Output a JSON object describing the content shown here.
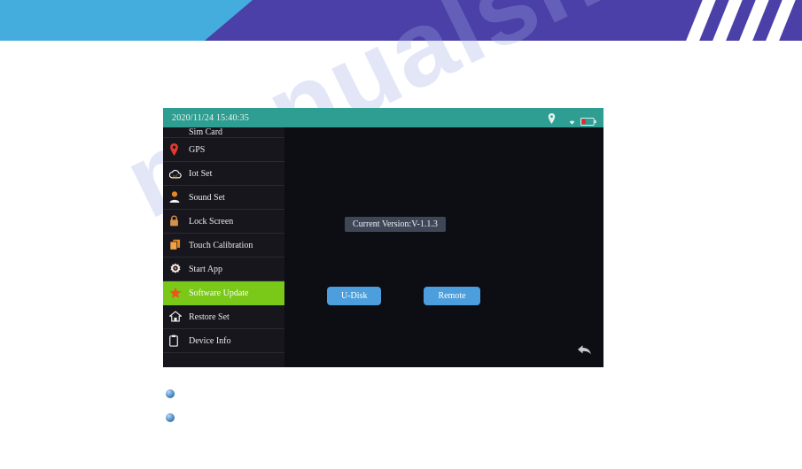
{
  "banner": {
    "blue_color": "#45adde",
    "purple_color": "#4b3fa8",
    "stripe_color": "#ffffff"
  },
  "watermark": {
    "text": "manualshive.com",
    "color": "#a0ace0"
  },
  "device": {
    "statusbar": {
      "datetime": "2020/11/24 15:40:35",
      "bg_color": "#2e9e92",
      "icons": [
        {
          "name": "location-pin-icon",
          "label": "GPS location"
        },
        {
          "name": "wifi-icon",
          "label": "WiFi signal"
        },
        {
          "name": "battery-icon",
          "label": "Battery low"
        }
      ]
    },
    "sidebar": {
      "active_color": "#7ac818",
      "items": [
        {
          "label": "Sim Card",
          "icon": "sim-card-icon",
          "active": false,
          "clipped": true
        },
        {
          "label": "GPS",
          "icon": "location-pin-icon",
          "active": false
        },
        {
          "label": "Iot Set",
          "icon": "cloud-iot-icon",
          "active": false
        },
        {
          "label": "Sound Set",
          "icon": "person-icon",
          "active": false
        },
        {
          "label": "Lock Screen",
          "icon": "lock-icon",
          "active": false
        },
        {
          "label": "Touch Calibration",
          "icon": "layered-cards-icon",
          "active": false
        },
        {
          "label": "Start App",
          "icon": "gear-icon",
          "active": false
        },
        {
          "label": "Software Update",
          "icon": "star-icon",
          "active": true
        },
        {
          "label": "Restore Set",
          "icon": "home-icon",
          "active": false
        },
        {
          "label": "Device Info",
          "icon": "clipboard-icon",
          "active": false
        }
      ]
    },
    "content": {
      "version_text": "Current Version:V-1.1.3",
      "version_bg": "#3f4756",
      "buttons": [
        {
          "label": "U-Disk",
          "name": "u-disk-button"
        },
        {
          "label": "Remote",
          "name": "remote-button"
        }
      ],
      "button_color": "#4c9fdc",
      "back_icon": "back-arrow-icon"
    }
  },
  "bullets": [
    {
      "name": "bullet-marker-1"
    },
    {
      "name": "bullet-marker-2"
    }
  ]
}
